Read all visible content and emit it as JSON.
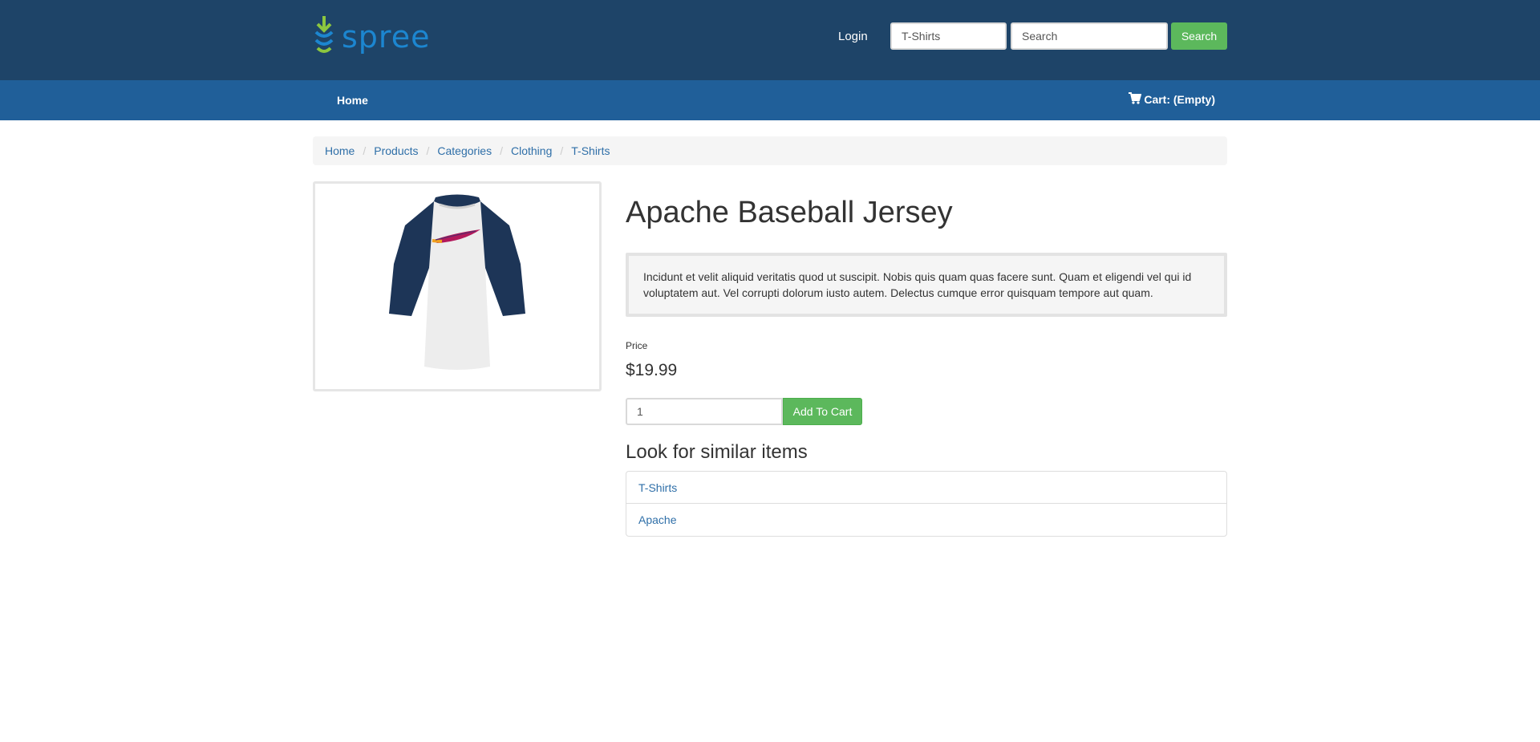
{
  "header": {
    "logo_text": "spree",
    "login_label": "Login",
    "taxon_select_value": "T-Shirts",
    "search_placeholder": "Search",
    "search_button_label": "Search",
    "bg_color": "#1e4468",
    "accent_color": "#5cb85c"
  },
  "navbar": {
    "home_label": "Home",
    "cart_label": "Cart: (Empty)",
    "cart_icon": "shopping-cart-icon",
    "bg_color": "#205f99"
  },
  "breadcrumb": [
    "Home",
    "Products",
    "Categories",
    "Clothing",
    "T-Shirts"
  ],
  "product": {
    "title": "Apache Baseball Jersey",
    "description": "Incidunt et velit aliquid veritatis quod ut suscipit. Nobis quis quam quas facere sunt. Quam et eligendi vel qui id voluptatem aut. Vel corrupti dolorum iusto autem. Delectus cumque error quisquam tempore aut quam.",
    "price_label": "Price",
    "price": "$19.99",
    "quantity": "1",
    "add_to_cart_label": "Add To Cart"
  },
  "similar": {
    "title": "Look for similar items",
    "items": [
      "T-Shirts",
      "Apache"
    ]
  }
}
